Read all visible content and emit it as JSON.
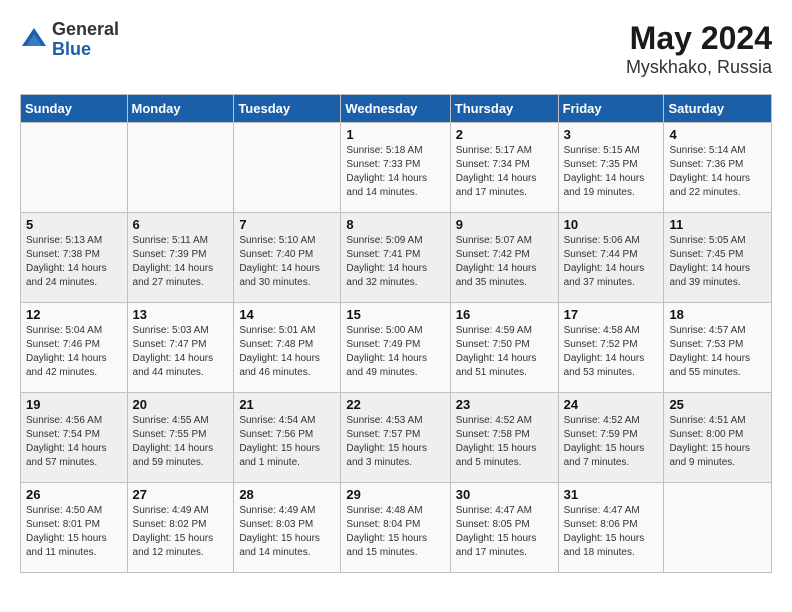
{
  "logo": {
    "general": "General",
    "blue": "Blue"
  },
  "title": "May 2024",
  "subtitle": "Myskhako, Russia",
  "headers": [
    "Sunday",
    "Monday",
    "Tuesday",
    "Wednesday",
    "Thursday",
    "Friday",
    "Saturday"
  ],
  "weeks": [
    [
      {
        "day": "",
        "detail": ""
      },
      {
        "day": "",
        "detail": ""
      },
      {
        "day": "",
        "detail": ""
      },
      {
        "day": "1",
        "detail": "Sunrise: 5:18 AM\nSunset: 7:33 PM\nDaylight: 14 hours\nand 14 minutes."
      },
      {
        "day": "2",
        "detail": "Sunrise: 5:17 AM\nSunset: 7:34 PM\nDaylight: 14 hours\nand 17 minutes."
      },
      {
        "day": "3",
        "detail": "Sunrise: 5:15 AM\nSunset: 7:35 PM\nDaylight: 14 hours\nand 19 minutes."
      },
      {
        "day": "4",
        "detail": "Sunrise: 5:14 AM\nSunset: 7:36 PM\nDaylight: 14 hours\nand 22 minutes."
      }
    ],
    [
      {
        "day": "5",
        "detail": "Sunrise: 5:13 AM\nSunset: 7:38 PM\nDaylight: 14 hours\nand 24 minutes."
      },
      {
        "day": "6",
        "detail": "Sunrise: 5:11 AM\nSunset: 7:39 PM\nDaylight: 14 hours\nand 27 minutes."
      },
      {
        "day": "7",
        "detail": "Sunrise: 5:10 AM\nSunset: 7:40 PM\nDaylight: 14 hours\nand 30 minutes."
      },
      {
        "day": "8",
        "detail": "Sunrise: 5:09 AM\nSunset: 7:41 PM\nDaylight: 14 hours\nand 32 minutes."
      },
      {
        "day": "9",
        "detail": "Sunrise: 5:07 AM\nSunset: 7:42 PM\nDaylight: 14 hours\nand 35 minutes."
      },
      {
        "day": "10",
        "detail": "Sunrise: 5:06 AM\nSunset: 7:44 PM\nDaylight: 14 hours\nand 37 minutes."
      },
      {
        "day": "11",
        "detail": "Sunrise: 5:05 AM\nSunset: 7:45 PM\nDaylight: 14 hours\nand 39 minutes."
      }
    ],
    [
      {
        "day": "12",
        "detail": "Sunrise: 5:04 AM\nSunset: 7:46 PM\nDaylight: 14 hours\nand 42 minutes."
      },
      {
        "day": "13",
        "detail": "Sunrise: 5:03 AM\nSunset: 7:47 PM\nDaylight: 14 hours\nand 44 minutes."
      },
      {
        "day": "14",
        "detail": "Sunrise: 5:01 AM\nSunset: 7:48 PM\nDaylight: 14 hours\nand 46 minutes."
      },
      {
        "day": "15",
        "detail": "Sunrise: 5:00 AM\nSunset: 7:49 PM\nDaylight: 14 hours\nand 49 minutes."
      },
      {
        "day": "16",
        "detail": "Sunrise: 4:59 AM\nSunset: 7:50 PM\nDaylight: 14 hours\nand 51 minutes."
      },
      {
        "day": "17",
        "detail": "Sunrise: 4:58 AM\nSunset: 7:52 PM\nDaylight: 14 hours\nand 53 minutes."
      },
      {
        "day": "18",
        "detail": "Sunrise: 4:57 AM\nSunset: 7:53 PM\nDaylight: 14 hours\nand 55 minutes."
      }
    ],
    [
      {
        "day": "19",
        "detail": "Sunrise: 4:56 AM\nSunset: 7:54 PM\nDaylight: 14 hours\nand 57 minutes."
      },
      {
        "day": "20",
        "detail": "Sunrise: 4:55 AM\nSunset: 7:55 PM\nDaylight: 14 hours\nand 59 minutes."
      },
      {
        "day": "21",
        "detail": "Sunrise: 4:54 AM\nSunset: 7:56 PM\nDaylight: 15 hours\nand 1 minute."
      },
      {
        "day": "22",
        "detail": "Sunrise: 4:53 AM\nSunset: 7:57 PM\nDaylight: 15 hours\nand 3 minutes."
      },
      {
        "day": "23",
        "detail": "Sunrise: 4:52 AM\nSunset: 7:58 PM\nDaylight: 15 hours\nand 5 minutes."
      },
      {
        "day": "24",
        "detail": "Sunrise: 4:52 AM\nSunset: 7:59 PM\nDaylight: 15 hours\nand 7 minutes."
      },
      {
        "day": "25",
        "detail": "Sunrise: 4:51 AM\nSunset: 8:00 PM\nDaylight: 15 hours\nand 9 minutes."
      }
    ],
    [
      {
        "day": "26",
        "detail": "Sunrise: 4:50 AM\nSunset: 8:01 PM\nDaylight: 15 hours\nand 11 minutes."
      },
      {
        "day": "27",
        "detail": "Sunrise: 4:49 AM\nSunset: 8:02 PM\nDaylight: 15 hours\nand 12 minutes."
      },
      {
        "day": "28",
        "detail": "Sunrise: 4:49 AM\nSunset: 8:03 PM\nDaylight: 15 hours\nand 14 minutes."
      },
      {
        "day": "29",
        "detail": "Sunrise: 4:48 AM\nSunset: 8:04 PM\nDaylight: 15 hours\nand 15 minutes."
      },
      {
        "day": "30",
        "detail": "Sunrise: 4:47 AM\nSunset: 8:05 PM\nDaylight: 15 hours\nand 17 minutes."
      },
      {
        "day": "31",
        "detail": "Sunrise: 4:47 AM\nSunset: 8:06 PM\nDaylight: 15 hours\nand 18 minutes."
      },
      {
        "day": "",
        "detail": ""
      }
    ]
  ]
}
